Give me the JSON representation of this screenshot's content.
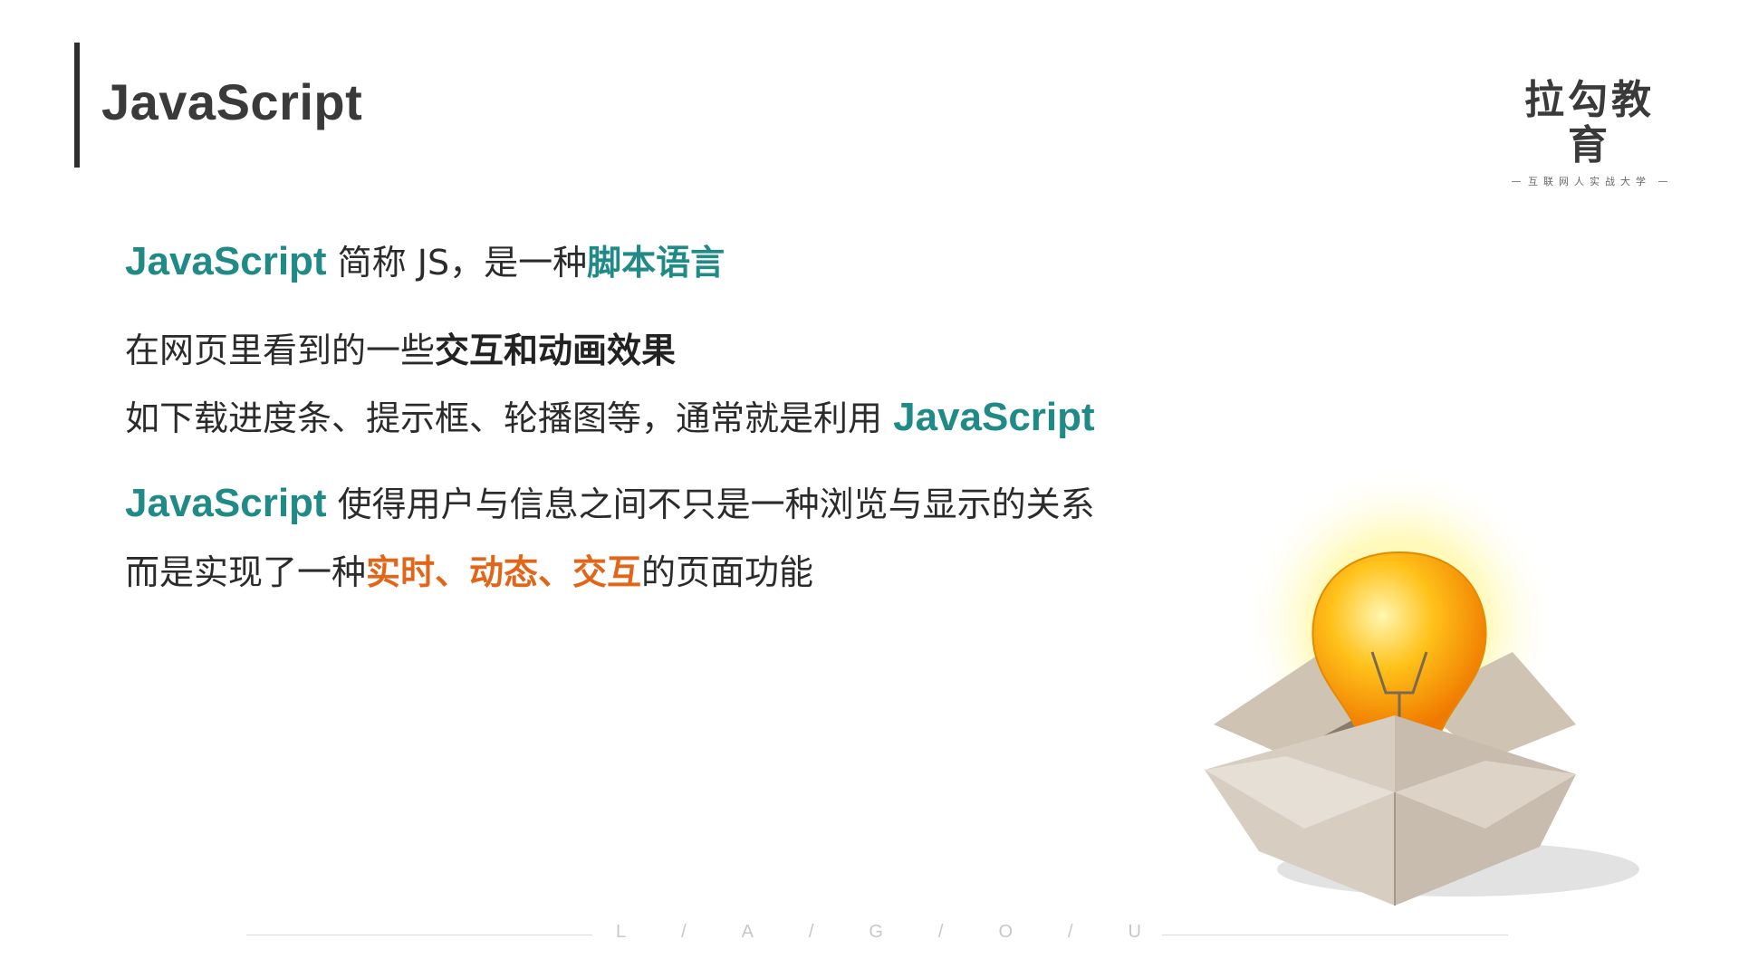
{
  "header": {
    "title": "JavaScript"
  },
  "logo": {
    "name": "拉勾教育",
    "tagline": "互联网人实战大学"
  },
  "content": {
    "line1": {
      "js": "JavaScript",
      "mid": " 简称 JS，是一种",
      "highlight": "脚本语言"
    },
    "line2": {
      "text": "在网页里看到的一些",
      "highlight": "交互和动画效果"
    },
    "line3": {
      "text": "如下载进度条、提示框、轮播图等，通常就是利用 ",
      "js": "JavaScript"
    },
    "line4": {
      "js": "JavaScript",
      "text": " 使得用户与信息之间不只是一种浏览与显示的关系"
    },
    "line5": {
      "text": "而是实现了一种",
      "highlight": "实时、动态、交互",
      "tail": "的页面功能"
    }
  },
  "footer": {
    "letters": [
      "L",
      "/",
      "A",
      "/",
      "G",
      "/",
      "O",
      "/",
      "U"
    ]
  },
  "colors": {
    "teal": "#1f8a86",
    "orange": "#e2661a",
    "dark": "#2b2b2b"
  },
  "illustration": {
    "icon": "lightbulb-in-box-icon"
  }
}
